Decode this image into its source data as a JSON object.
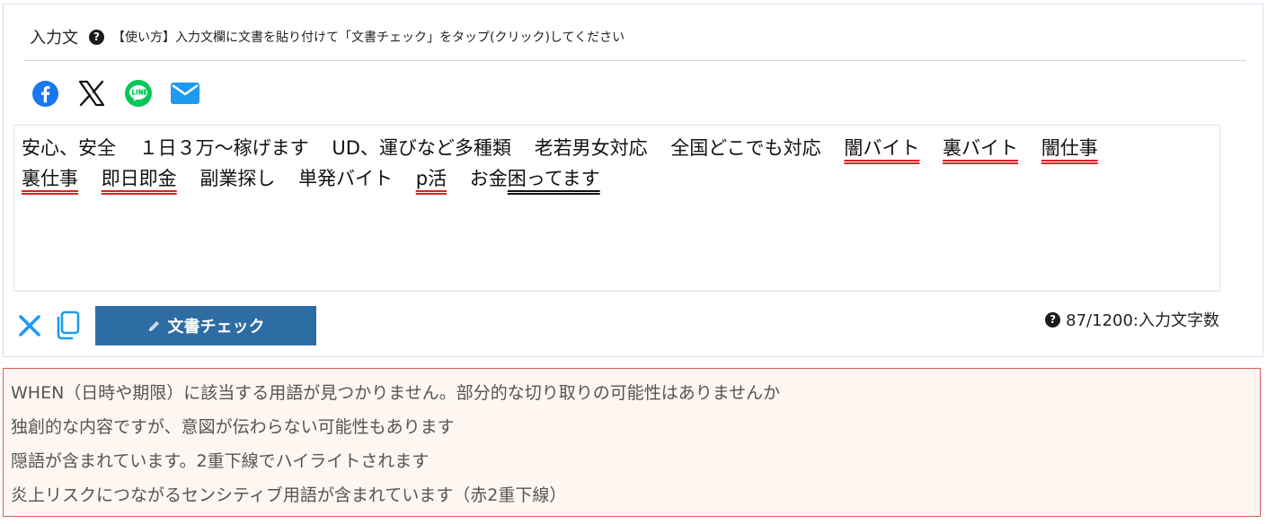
{
  "header": {
    "title": "入力文",
    "help_icon": "question-circle-icon",
    "instruction": "【使い方】入力文欄に文書を貼り付けて「文書チェック」をタップ(クリック)してください"
  },
  "share": {
    "facebook_icon": "facebook-icon",
    "x_icon": "x-icon",
    "line_icon": "line-icon",
    "mail_icon": "mail-icon"
  },
  "input_text": {
    "line1": [
      {
        "text": "安心、安全",
        "mark": "none"
      },
      {
        "text": "１日３万〜稼げます",
        "mark": "none"
      },
      {
        "text": "UD、運びなど多種類",
        "mark": "none"
      },
      {
        "text": "老若男女対応",
        "mark": "none"
      },
      {
        "text": "全国どこでも対応",
        "mark": "none"
      },
      {
        "text": "闇バイト",
        "mark": "red"
      },
      {
        "text": "裏バイト",
        "mark": "red"
      },
      {
        "text": "闇仕事",
        "mark": "red"
      }
    ],
    "line2": [
      {
        "text": "裏仕事",
        "mark": "red"
      },
      {
        "text": "即日即金",
        "mark": "red"
      },
      {
        "text": "副業探し",
        "mark": "none"
      },
      {
        "text": "単発バイト",
        "mark": "none"
      },
      {
        "text": "p活",
        "mark": "red"
      },
      {
        "text": "お金",
        "mark": "none"
      },
      {
        "text": "困ってます",
        "mark": "black"
      }
    ]
  },
  "toolbar": {
    "clear_icon": "close-icon",
    "copy_icon": "copy-icon",
    "check_label": "文書チェック",
    "count_text": "87/1200:入力文字数"
  },
  "colors": {
    "primary": "#2e6da4",
    "sensitive_underline": "#e02020",
    "jargon_underline": "#111111",
    "result_border": "#e05a5a",
    "result_bg": "#fdf6f1"
  },
  "results": [
    "WHEN（日時や期限）に該当する用語が見つかりません。部分的な切り取りの可能性はありませんか",
    "独創的な内容ですが、意図が伝わらない可能性もあります",
    "隠語が含まれています。2重下線でハイライトされます",
    "炎上リスクにつながるセンシティブ用語が含まれています（赤2重下線）"
  ]
}
